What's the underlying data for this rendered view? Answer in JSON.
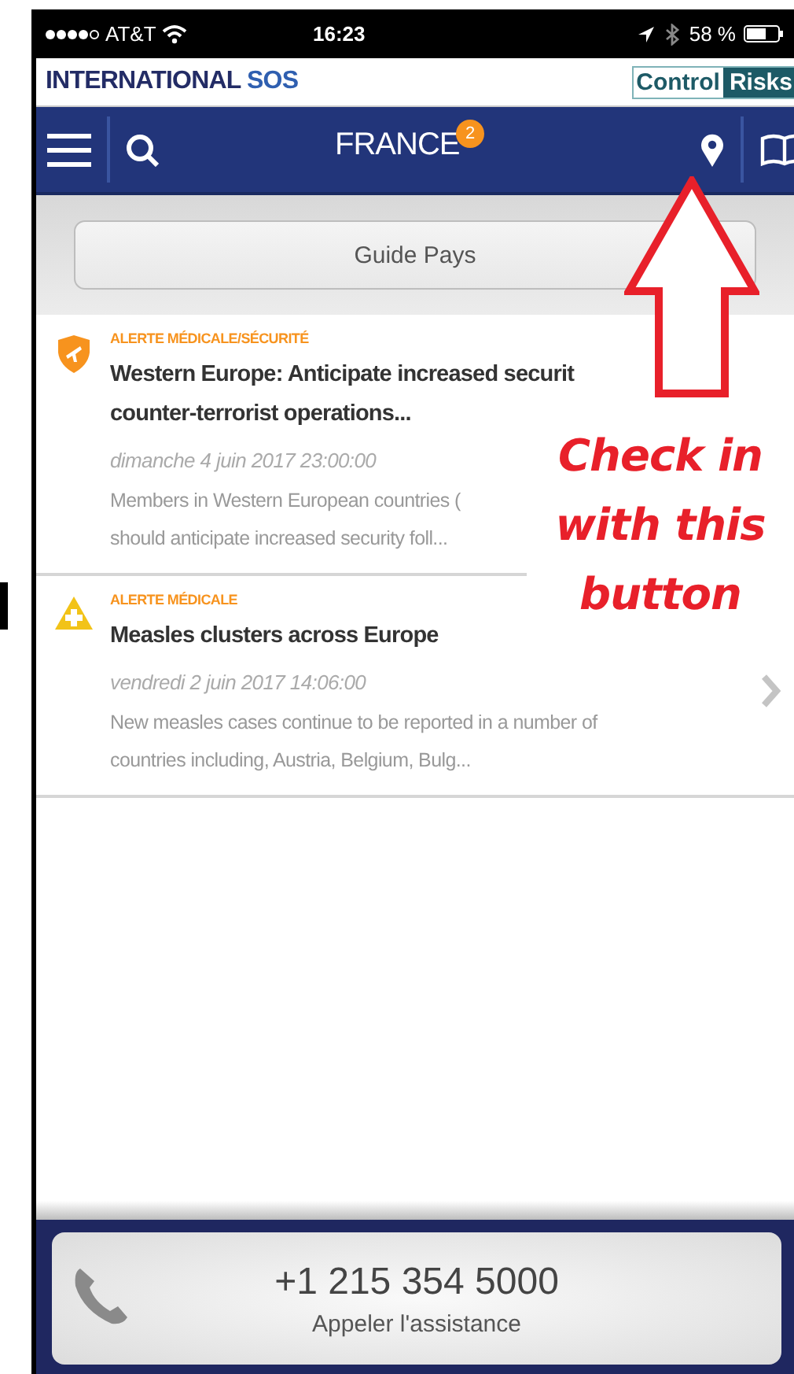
{
  "status_bar": {
    "carrier": "AT&T",
    "time": "16:23",
    "battery": "58 %"
  },
  "header": {
    "brand": [
      "INTERNATIONAL",
      "SOS"
    ],
    "partner": [
      "Control",
      "Risks"
    ]
  },
  "nav": {
    "title": "FRANCE",
    "badge": "2"
  },
  "guide_button": "Guide Pays",
  "alerts": [
    {
      "kind": "security",
      "category": "ALERTE MÉDICALE/SÉCURITÉ",
      "title": "Western Europe: Anticipate increased securit\ncounter-terrorist operations...",
      "date": "dimanche 4 juin 2017 23:00:00",
      "summary": "Members in Western European countries (\nshould anticipate increased security foll...",
      "chevron": false
    },
    {
      "kind": "medical",
      "category": "ALERTE MÉDICALE",
      "title": "Measles clusters across Europe",
      "date": "vendredi 2 juin 2017 14:06:00",
      "summary": "New measles cases continue to be reported in a number of\ncountries including, Austria, Belgium, Bulg...",
      "chevron": true
    }
  ],
  "call": {
    "phone": "+1 215 354 5000",
    "label": "Appeler l'assistance"
  },
  "annotation": {
    "text": "Check in\nwith this\nbutton"
  }
}
